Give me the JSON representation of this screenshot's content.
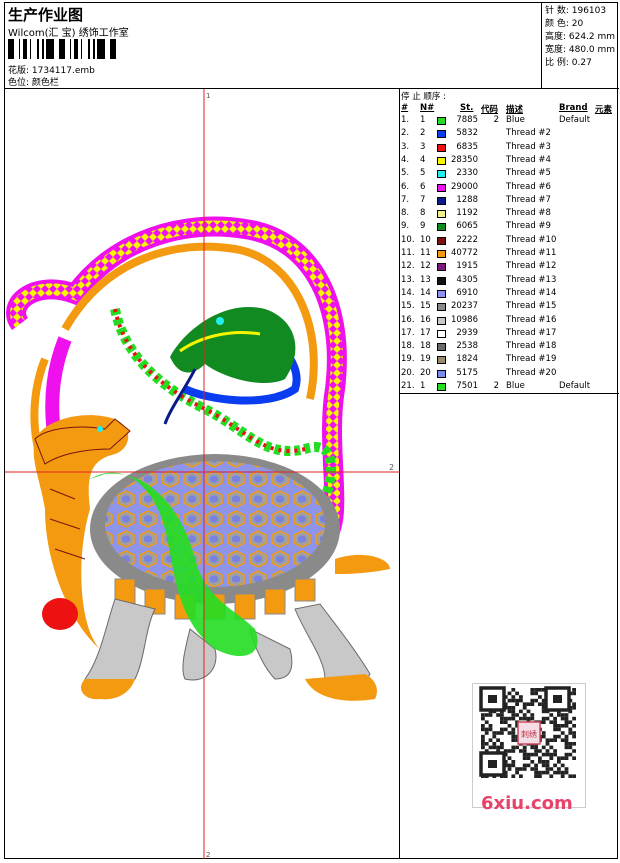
{
  "header": {
    "title": "生产作业图",
    "company": "Wilcom(汇 宝) 绣饰工作室",
    "design_label": "花版: 1734117.emb",
    "colorway_label": "色位: 颜色栏"
  },
  "stats": {
    "stitches": "针 数: 196103",
    "colors": "颜 色: 20",
    "height": "高度: 624.2 mm",
    "width": "宽度: 480.0 mm",
    "scale": "比 例: 0.27"
  },
  "canvas": {
    "mark_top": "1",
    "mark_right": "2",
    "mark_bottom": "2"
  },
  "sequence": {
    "stop_label": "停 止 顺序 :",
    "headers": [
      "#",
      "N#",
      "St.",
      "代码",
      "描述",
      "Brand",
      "元素"
    ],
    "rows": [
      {
        "idx": "1.",
        "n": "1",
        "color": "#22dd22",
        "st": "7885",
        "code": "2",
        "desc": "Blue",
        "brand": "Default"
      },
      {
        "idx": "2.",
        "n": "2",
        "color": "#0a3cf0",
        "st": "5832",
        "code": "",
        "desc": "Thread #2",
        "brand": ""
      },
      {
        "idx": "3.",
        "n": "3",
        "color": "#ee1111",
        "st": "6835",
        "code": "",
        "desc": "Thread #3",
        "brand": ""
      },
      {
        "idx": "4.",
        "n": "4",
        "color": "#f5f500",
        "st": "28350",
        "code": "",
        "desc": "Thread #4",
        "brand": ""
      },
      {
        "idx": "5.",
        "n": "5",
        "color": "#22eeee",
        "st": "2330",
        "code": "",
        "desc": "Thread #5",
        "brand": ""
      },
      {
        "idx": "6.",
        "n": "6",
        "color": "#ee11ee",
        "st": "29000",
        "code": "",
        "desc": "Thread #6",
        "brand": ""
      },
      {
        "idx": "7.",
        "n": "7",
        "color": "#0a1a88",
        "st": "1288",
        "code": "",
        "desc": "Thread #7",
        "brand": ""
      },
      {
        "idx": "8.",
        "n": "8",
        "color": "#f3ef88",
        "st": "1192",
        "code": "",
        "desc": "Thread #8",
        "brand": ""
      },
      {
        "idx": "9.",
        "n": "9",
        "color": "#128a22",
        "st": "6065",
        "code": "",
        "desc": "Thread #9",
        "brand": ""
      },
      {
        "idx": "10.",
        "n": "10",
        "color": "#7a1111",
        "st": "2222",
        "code": "",
        "desc": "Thread #10",
        "brand": ""
      },
      {
        "idx": "11.",
        "n": "11",
        "color": "#f39a11",
        "st": "40772",
        "code": "",
        "desc": "Thread #11",
        "brand": ""
      },
      {
        "idx": "12.",
        "n": "12",
        "color": "#7a1a7a",
        "st": "1915",
        "code": "",
        "desc": "Thread #12",
        "brand": ""
      },
      {
        "idx": "13.",
        "n": "13",
        "color": "#111111",
        "st": "4305",
        "code": "",
        "desc": "Thread #13",
        "brand": ""
      },
      {
        "idx": "14.",
        "n": "14",
        "color": "#9090ee",
        "st": "6910",
        "code": "",
        "desc": "Thread #14",
        "brand": ""
      },
      {
        "idx": "15.",
        "n": "15",
        "color": "#8a8a8a",
        "st": "20237",
        "code": "",
        "desc": "Thread #15",
        "brand": ""
      },
      {
        "idx": "16.",
        "n": "16",
        "color": "#c8c8c8",
        "st": "10986",
        "code": "",
        "desc": "Thread #16",
        "brand": ""
      },
      {
        "idx": "17.",
        "n": "17",
        "color": "#ffffff",
        "st": "2939",
        "code": "",
        "desc": "Thread #17",
        "brand": ""
      },
      {
        "idx": "18.",
        "n": "18",
        "color": "#6a6a6a",
        "st": "2538",
        "code": "",
        "desc": "Thread #18",
        "brand": ""
      },
      {
        "idx": "19.",
        "n": "19",
        "color": "#9a8c66",
        "st": "1824",
        "code": "",
        "desc": "Thread #19",
        "brand": ""
      },
      {
        "idx": "20.",
        "n": "20",
        "color": "#7a8aee",
        "st": "5175",
        "code": "",
        "desc": "Thread #20",
        "brand": ""
      },
      {
        "idx": "21.",
        "n": "1",
        "color": "#22dd22",
        "st": "7501",
        "code": "2",
        "desc": "Blue",
        "brand": "Default"
      }
    ]
  },
  "watermark": {
    "site": "6xiu.com",
    "seal_text": "刺绣"
  }
}
